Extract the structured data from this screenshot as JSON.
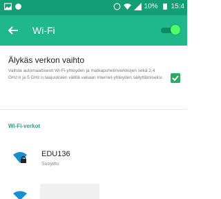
{
  "status_bar": {
    "battery": "10%",
    "time": "15:4"
  },
  "app_bar": {
    "title": "Wi-Fi",
    "wifi_enabled": true
  },
  "smart_network_switch": {
    "title": "Älykäs verkon vaihto",
    "description": "Vaihda automaattisesti Wi-Fi-yhteyden ja matkapuhelinverkkojen sekä 2,4 GHz:n ja 5 GHz:n taajuuksien välillä vakaan Internet-yhteyden säilyttämiseksi.",
    "checked": true
  },
  "networks_section": {
    "header": "Wi-Fi-verkot",
    "items": [
      {
        "name": "EDU136",
        "status": "Suojattu",
        "secured": true
      }
    ]
  },
  "colors": {
    "status_bar": "#139e75",
    "app_bar": "#1fb88a",
    "accent": "#2ea862"
  }
}
